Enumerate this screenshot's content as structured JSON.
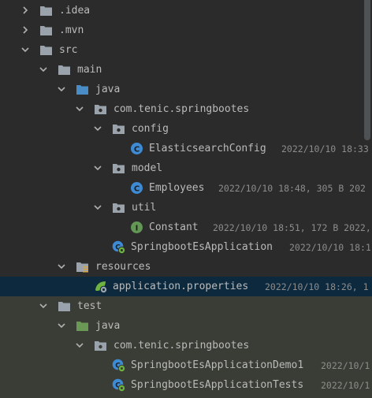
{
  "colors": {
    "background": "#2b2b2b",
    "selected_row": "#0d293e",
    "test_rows": "#3a3d35",
    "text": "#bbbbbb",
    "meta_text": "#8c8c8c",
    "folder_grey": "#9aa3ab",
    "folder_blue": "#4a8cc6",
    "folder_green": "#6a9955",
    "class_blue": "#3d8bd4",
    "interface_green": "#629755",
    "spring_green": "#6db33f"
  },
  "tree": {
    "items": [
      {
        "label": ".idea",
        "meta": "",
        "icon": "folder-icon",
        "arrow": "chevron-right-icon"
      },
      {
        "label": ".mvn",
        "meta": "",
        "icon": "folder-icon",
        "arrow": "chevron-right-icon"
      },
      {
        "label": "src",
        "meta": "",
        "icon": "folder-icon",
        "arrow": "chevron-down-icon"
      },
      {
        "label": "main",
        "meta": "",
        "icon": "folder-icon",
        "arrow": "chevron-down-icon"
      },
      {
        "label": "java",
        "meta": "",
        "icon": "source-folder-icon",
        "arrow": "chevron-down-icon"
      },
      {
        "label": "com.tenic.springbootes",
        "meta": "",
        "icon": "package-icon",
        "arrow": "chevron-down-icon"
      },
      {
        "label": "config",
        "meta": "",
        "icon": "package-icon",
        "arrow": "chevron-down-icon"
      },
      {
        "label": "ElasticsearchConfig",
        "meta": "2022/10/10 18:33",
        "icon": "class-icon",
        "arrow": ""
      },
      {
        "label": "model",
        "meta": "",
        "icon": "package-icon",
        "arrow": "chevron-down-icon"
      },
      {
        "label": "Employees",
        "meta": "2022/10/10 18:48, 305 B 202",
        "icon": "class-icon",
        "arrow": ""
      },
      {
        "label": "util",
        "meta": "",
        "icon": "package-icon",
        "arrow": "chevron-down-icon"
      },
      {
        "label": "Constant",
        "meta": "2022/10/10 18:51, 172 B 2022,",
        "icon": "interface-icon",
        "arrow": ""
      },
      {
        "label": "SpringbootEsApplication",
        "meta": "2022/10/10 18:1",
        "icon": "spring-boot-class-icon",
        "arrow": ""
      },
      {
        "label": "resources",
        "meta": "",
        "icon": "resources-folder-icon",
        "arrow": "chevron-down-icon"
      },
      {
        "label": "application.properties",
        "meta": "2022/10/10 18:26, 1",
        "icon": "spring-properties-icon",
        "arrow": ""
      },
      {
        "label": "test",
        "meta": "",
        "icon": "folder-icon",
        "arrow": "chevron-down-icon"
      },
      {
        "label": "java",
        "meta": "",
        "icon": "test-source-folder-icon",
        "arrow": "chevron-down-icon"
      },
      {
        "label": "com.tenic.springbootes",
        "meta": "",
        "icon": "package-icon",
        "arrow": "chevron-down-icon"
      },
      {
        "label": "SpringbootEsApplicationDemo1",
        "meta": "2022/10/1",
        "icon": "spring-test-class-icon",
        "arrow": ""
      },
      {
        "label": "SpringbootEsApplicationTests",
        "meta": "2022/10/1",
        "icon": "spring-test-class-icon",
        "arrow": ""
      }
    ]
  }
}
